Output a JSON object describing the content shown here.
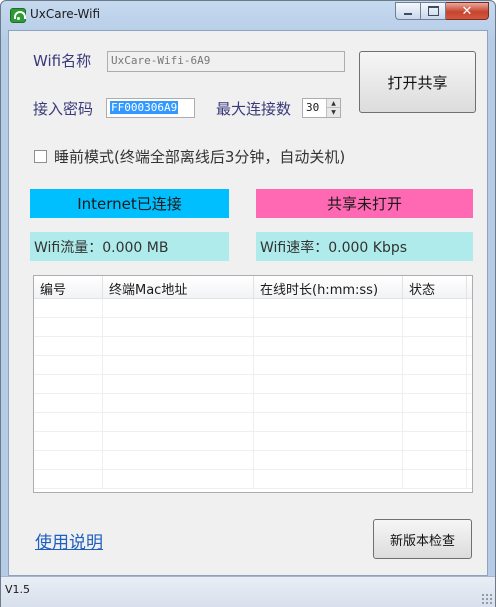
{
  "window": {
    "title": "UxCare-Wifi",
    "icon": "wifi-app-icon"
  },
  "settings": {
    "wifi_name_label": "Wifi名称",
    "wifi_name_value": "UxCare-Wifi-6A9",
    "password_label": "接入密码",
    "password_value": "FF000306A9",
    "max_conn_label": "最大连接数",
    "max_conn_value": "30",
    "sleep_mode_label": "睡前模式(终端全部离线后3分钟，自动关机)",
    "sleep_mode_checked": false
  },
  "buttons": {
    "share": "打开共享",
    "check_update": "新版本检查"
  },
  "status": {
    "internet": "Internet已连接",
    "internet_color": "#00bfff",
    "share": "共享未打开",
    "share_color": "#ff69b4",
    "traffic": "Wifi流量：0.000 MB",
    "speed": "Wifi速率：0.000 Kbps",
    "stat_bg": "#afebeb"
  },
  "table": {
    "columns": [
      "编号",
      "终端Mac地址",
      "在线时长(h:mm:ss)",
      "状态"
    ],
    "rows": []
  },
  "help_link": "使用说明",
  "version": "V1.5"
}
